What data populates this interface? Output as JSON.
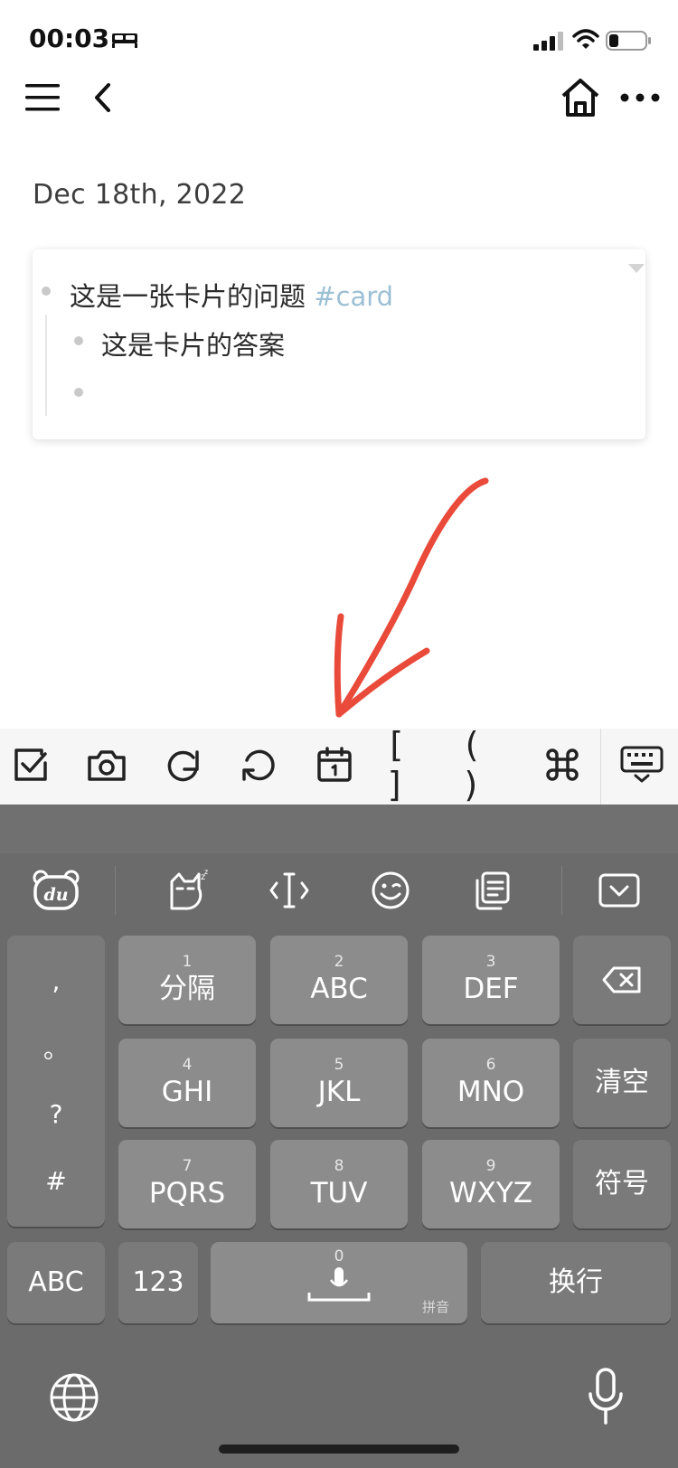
{
  "status_bar": {
    "time": "00:03"
  },
  "page": {
    "title": "Dec 18th, 2022",
    "card": {
      "question": "这是一张卡片的问题",
      "tag": "#card",
      "answer": "这是卡片的答案"
    }
  },
  "toolbar": {
    "link_brackets": "[ ]",
    "ref_parens": "( )"
  },
  "keyboard": {
    "punctuation": [
      ",",
      "。",
      "?",
      "#"
    ],
    "keys": [
      {
        "num": "1",
        "label": "分隔"
      },
      {
        "num": "2",
        "label": "ABC"
      },
      {
        "num": "3",
        "label": "DEF"
      },
      {
        "num": "4",
        "label": "GHI"
      },
      {
        "num": "5",
        "label": "JKL"
      },
      {
        "num": "6",
        "label": "MNO"
      },
      {
        "num": "7",
        "label": "PQRS"
      },
      {
        "num": "8",
        "label": "TUV"
      },
      {
        "num": "9",
        "label": "WXYZ"
      }
    ],
    "clear": "清空",
    "symbols": "符号",
    "abc": "ABC",
    "num_mode": "123",
    "space_num": "0",
    "pinyin": "拼音",
    "enter": "换行"
  },
  "colors": {
    "tag": "#9bbfd4",
    "annotation_arrow": "#e94a3a",
    "keyboard_bg": "#6b6b6b",
    "key_bg": "#8c8c8c"
  }
}
